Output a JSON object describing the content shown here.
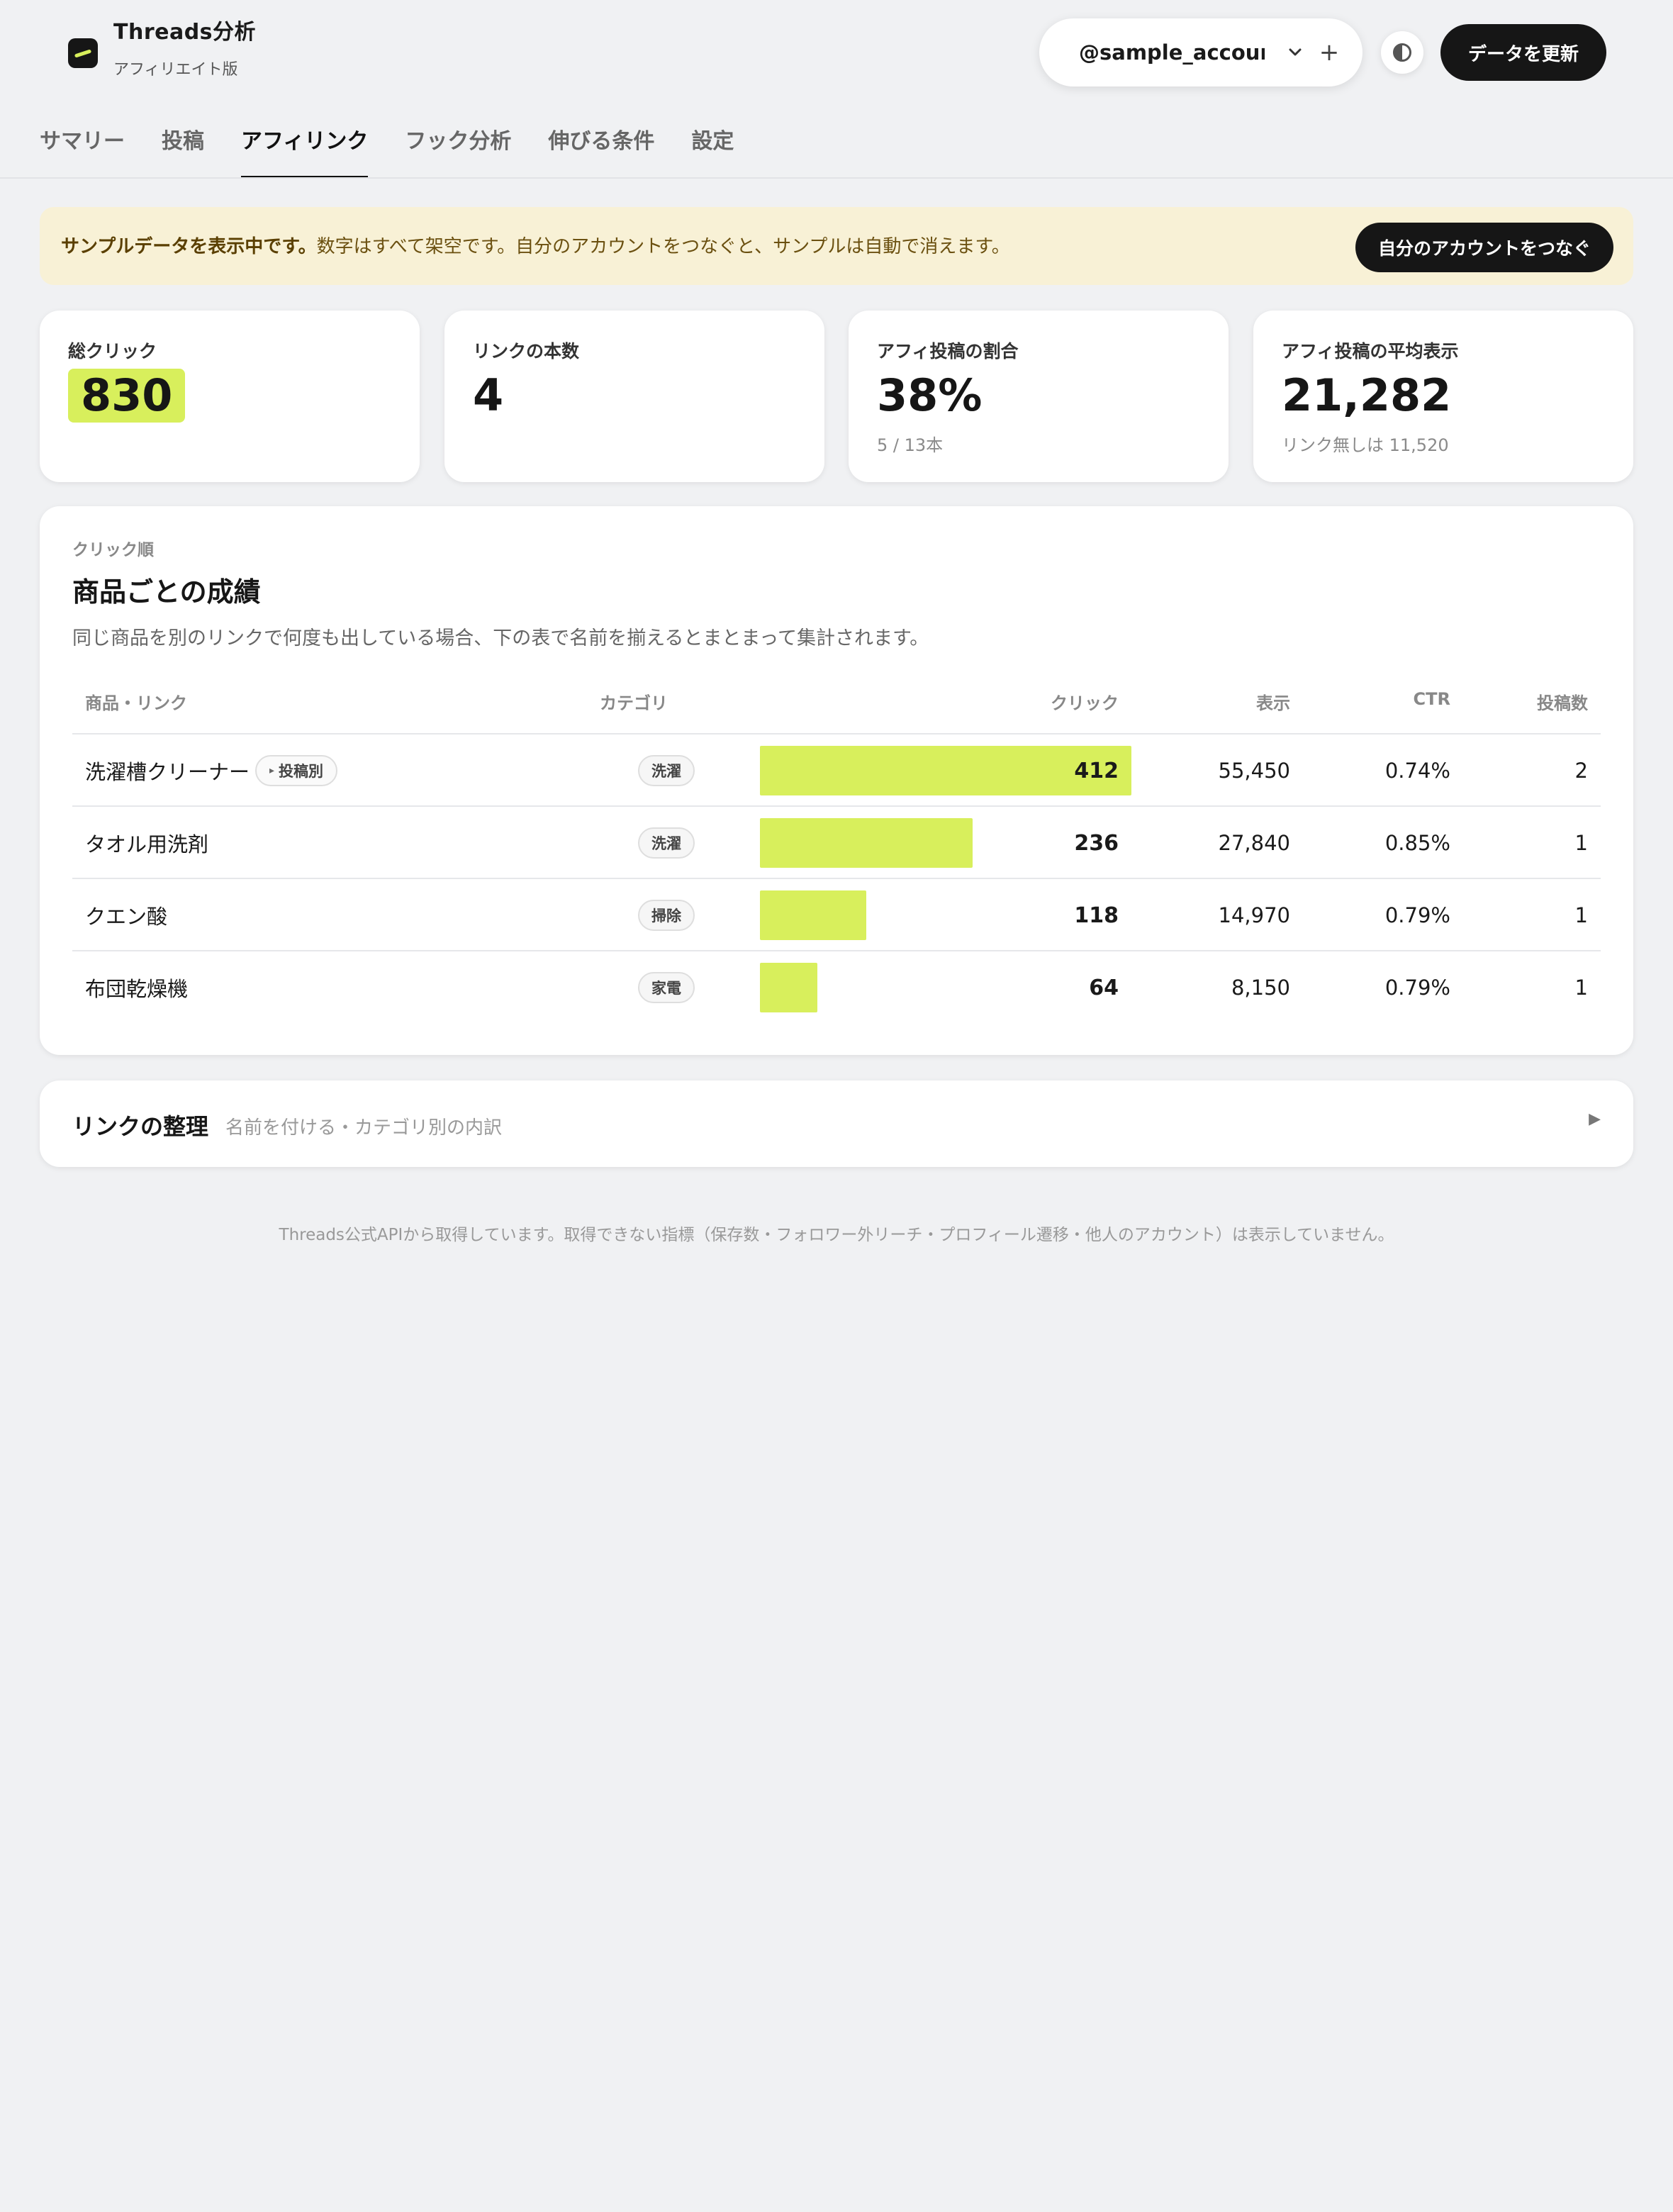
{
  "brand": {
    "title": "Threads分析",
    "subtitle": "アフィリエイト版"
  },
  "account": {
    "handle": "@sample_account",
    "add_icon": "plus-icon",
    "chevron_icon": "chevron-down-icon"
  },
  "toolbar": {
    "theme_icon": "contrast-icon",
    "refresh_label": "データを更新"
  },
  "tabs": [
    {
      "label": "サマリー",
      "active": false
    },
    {
      "label": "投稿",
      "active": false
    },
    {
      "label": "アフィリンク",
      "active": true
    },
    {
      "label": "フック分析",
      "active": false
    },
    {
      "label": "伸びる条件",
      "active": false
    },
    {
      "label": "設定",
      "active": false
    }
  ],
  "banner": {
    "strong": "サンプルデータを表示中です。",
    "text": "数字はすべて架空です。自分のアカウントをつなぐと、サンプルは自動で消えます。",
    "button": "自分のアカウントをつなぐ"
  },
  "stats": [
    {
      "label": "総クリック",
      "value": "830",
      "sub": ""
    },
    {
      "label": "リンクの本数",
      "value": "4",
      "sub": ""
    },
    {
      "label": "アフィ投稿の割合",
      "value": "38%",
      "sub": "5 / 13本"
    },
    {
      "label": "アフィ投稿の平均表示",
      "value": "21,282",
      "sub": "リンク無しは 11,520"
    }
  ],
  "products": {
    "eyebrow": "クリック順",
    "title": "商品ごとの成績",
    "description": "同じ商品を別のリンクで何度も出している場合、下の表で名前を揃えるとまとまって集計されます。",
    "headers": {
      "name": "商品・リンク",
      "category": "カテゴリ",
      "clicks": "クリック",
      "impressions": "表示",
      "ctr": "CTR",
      "posts": "投稿数"
    },
    "post_chip_label": "投稿別",
    "max_clicks": 412,
    "rows": [
      {
        "name": "洗濯槽クリーナー",
        "has_post_chip": true,
        "category": "洗濯",
        "clicks": 412,
        "clicks_label": "412",
        "impressions": "55,450",
        "ctr": "0.74%",
        "posts": "2"
      },
      {
        "name": "タオル用洗剤",
        "has_post_chip": false,
        "category": "洗濯",
        "clicks": 236,
        "clicks_label": "236",
        "impressions": "27,840",
        "ctr": "0.85%",
        "posts": "1"
      },
      {
        "name": "クエン酸",
        "has_post_chip": false,
        "category": "掃除",
        "clicks": 118,
        "clicks_label": "118",
        "impressions": "14,970",
        "ctr": "0.79%",
        "posts": "1"
      },
      {
        "name": "布団乾燥機",
        "has_post_chip": false,
        "category": "家電",
        "clicks": 64,
        "clicks_label": "64",
        "impressions": "8,150",
        "ctr": "0.79%",
        "posts": "1"
      }
    ]
  },
  "links_card": {
    "title": "リンクの整理",
    "subtitle": "名前を付ける・カテゴリ別の内訳",
    "arrow_icon": "triangle-right-icon"
  },
  "footnote": "Threads公式APIから取得しています。取得できない指標（保存数・フォロワー外リーチ・プロフィール遷移・他人のアカウント）は表示していません。",
  "colors": {
    "accent": "#d8ef5c",
    "dark": "#161616",
    "banner_bg": "#f8f1d6",
    "page_bg": "#f0f1f3"
  }
}
